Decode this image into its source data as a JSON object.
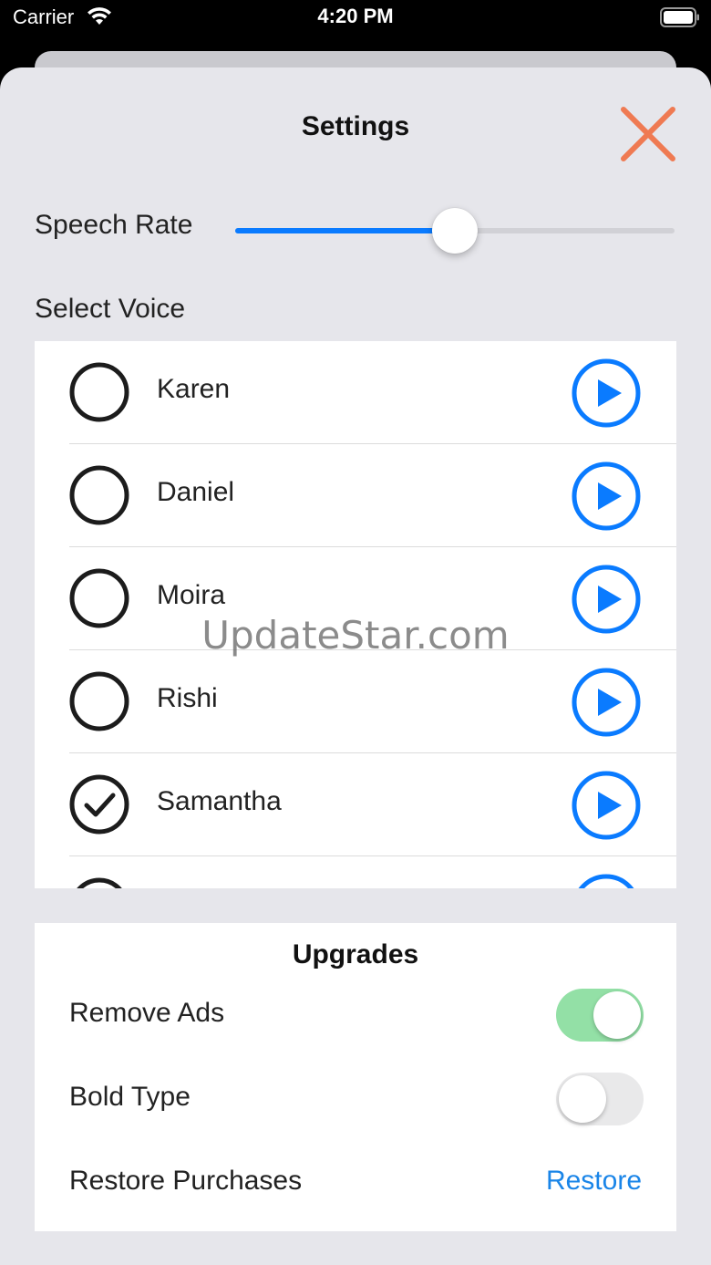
{
  "status_bar": {
    "carrier": "Carrier",
    "time": "4:20 PM"
  },
  "header": {
    "title": "Settings",
    "close_icon": "close-x-icon",
    "close_color": "#ef7a52"
  },
  "speech_rate": {
    "label": "Speech Rate",
    "value_fraction": 0.5,
    "accent_color": "#0a7bff"
  },
  "voice_section": {
    "label": "Select Voice",
    "voices": [
      {
        "name": "Karen",
        "selected": false
      },
      {
        "name": "Daniel",
        "selected": false
      },
      {
        "name": "Moira",
        "selected": false
      },
      {
        "name": "Rishi",
        "selected": false
      },
      {
        "name": "Samantha",
        "selected": true
      }
    ],
    "play_icon": "play-icon",
    "play_color": "#0a7bff"
  },
  "watermark": "UpdateStar.com",
  "upgrades": {
    "title": "Upgrades",
    "remove_ads": {
      "label": "Remove Ads",
      "on": true
    },
    "bold_type": {
      "label": "Bold Type",
      "on": false
    },
    "restore_purchases": {
      "label": "Restore Purchases",
      "action": "Restore"
    },
    "toggle_on_color": "#93e0a6",
    "toggle_off_color": "#e9e9ea",
    "link_color": "#1a85e8"
  }
}
